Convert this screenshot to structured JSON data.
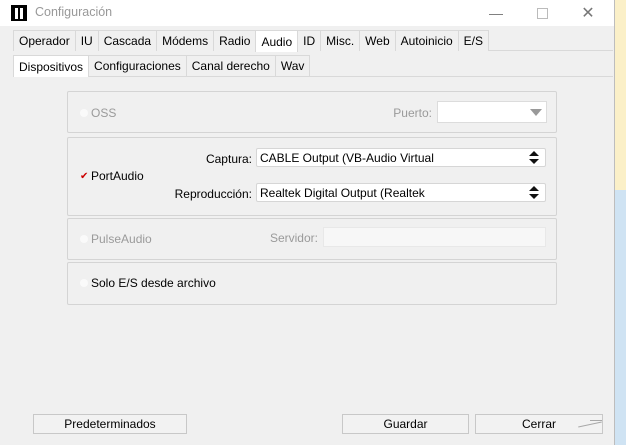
{
  "window": {
    "title": "Configuración"
  },
  "tabs_primary": [
    "Operador",
    "IU",
    "Cascada",
    "Módems",
    "Radio",
    "Audio",
    "ID",
    "Misc.",
    "Web",
    "Autoinicio",
    "E/S"
  ],
  "tabs_primary_active": "Audio",
  "tabs_secondary": [
    "Dispositivos",
    "Configuraciones",
    "Canal derecho",
    "Wav"
  ],
  "tabs_secondary_active": "Dispositivos",
  "oss": {
    "label": "OSS",
    "port_label": "Puerto:",
    "port_value": ""
  },
  "portaudio": {
    "label": "PortAudio",
    "checked": true,
    "capture_label": "Captura:",
    "capture_value": "CABLE Output (VB-Audio Virtual",
    "playback_label": "Reproducción:",
    "playback_value": "Realtek Digital Output (Realtek"
  },
  "pulseaudio": {
    "label": "PulseAudio",
    "server_label": "Servidor:",
    "server_value": ""
  },
  "file_only": {
    "label": "Solo E/S desde archivo"
  },
  "buttons": {
    "defaults": "Predeterminados",
    "save": "Guardar",
    "close": "Cerrar"
  }
}
